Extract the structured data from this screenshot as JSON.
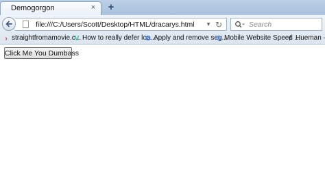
{
  "tab": {
    "title": "Demogorgon",
    "close_glyph": "×",
    "new_tab_glyph": "+"
  },
  "navbar": {
    "url": "file:///C:/Users/Scott/Desktop/HTML/dracarys.html",
    "search_placeholder": "Search"
  },
  "bookmarks": [
    {
      "label": "straightfromamovie.c...",
      "icon": "red-chevron-icon"
    },
    {
      "label": "How to really defer loa...",
      "icon": "v-logo-icon"
    },
    {
      "label": "Apply and remove seg...",
      "icon": "google-icon"
    },
    {
      "label": "Mobile Website Speed ...",
      "icon": "google-icon"
    },
    {
      "label": "Hueman –",
      "icon": "hueman-icon"
    }
  ],
  "page": {
    "button_label": "Click Me You Dumbass"
  }
}
